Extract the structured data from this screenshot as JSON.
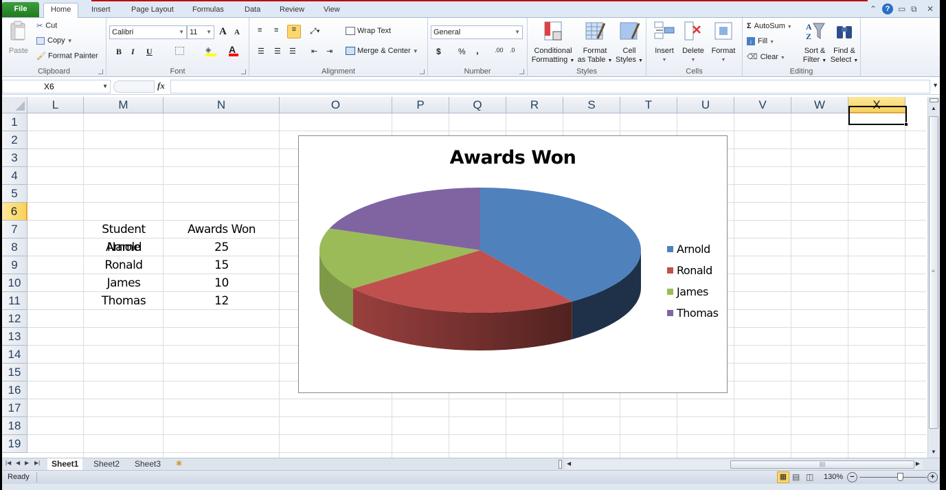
{
  "ribbon_tabs": [
    "File",
    "Home",
    "Insert",
    "Page Layout",
    "Formulas",
    "Data",
    "Review",
    "View"
  ],
  "active_tab": "Home",
  "window_controls": {
    "minimize_ribbon": "⌃",
    "help": "?",
    "minimize": "▭",
    "restore": "⧉",
    "close": "✕"
  },
  "clipboard": {
    "paste": "Paste",
    "cut": "Cut",
    "copy": "Copy",
    "format_painter": "Format Painter",
    "label": "Clipboard"
  },
  "font": {
    "name": "Calibri",
    "size": "11",
    "grow": "A",
    "shrink": "A",
    "bold": "B",
    "italic": "I",
    "underline": "U",
    "label": "Font",
    "fill_color": "#ffff00",
    "font_color": "#ff0000"
  },
  "alignment": {
    "wrap_text": "Wrap Text",
    "merge_center": "Merge & Center",
    "label": "Alignment"
  },
  "number": {
    "format": "General",
    "currency": "$",
    "percent": "%",
    "comma": ",",
    "inc_decimal": ".00",
    "dec_decimal": ".0",
    "label": "Number"
  },
  "styles": {
    "conditional_formatting": [
      "Conditional",
      "Formatting"
    ],
    "format_as_table": [
      "Format",
      "as Table"
    ],
    "cell_styles": [
      "Cell",
      "Styles"
    ],
    "label": "Styles"
  },
  "cells": {
    "insert": "Insert",
    "delete": "Delete",
    "format": "Format",
    "label": "Cells"
  },
  "editing": {
    "autosum": "AutoSum",
    "fill": "Fill",
    "clear": "Clear",
    "sort_filter": [
      "Sort &",
      "Filter"
    ],
    "find_select": [
      "Find &",
      "Select"
    ],
    "label": "Editing"
  },
  "formula_bar": {
    "name_box": "X6",
    "fx": "fx",
    "formula": ""
  },
  "columns": [
    "L",
    "M",
    "N",
    "O",
    "P",
    "Q",
    "R",
    "S",
    "T",
    "U",
    "V",
    "W",
    "X"
  ],
  "selected_column": "X",
  "rows": [
    "1",
    "2",
    "3",
    "4",
    "5",
    "6",
    "7",
    "8",
    "9",
    "10",
    "11",
    "12",
    "13",
    "14",
    "15",
    "16",
    "17",
    "18",
    "19"
  ],
  "selected_row": "6",
  "table": {
    "headers": [
      "Student Name",
      "Awards Won"
    ],
    "rows": [
      [
        "Arnold",
        "25"
      ],
      [
        "Ronald",
        "15"
      ],
      [
        "James",
        "10"
      ],
      [
        "Thomas",
        "12"
      ]
    ]
  },
  "chart_data": {
    "type": "pie",
    "style": "3d",
    "title": "Awards Won",
    "categories": [
      "Arnold",
      "Ronald",
      "James",
      "Thomas"
    ],
    "values": [
      25,
      15,
      10,
      12
    ],
    "colors": [
      "#4f81bd",
      "#c0504d",
      "#9bbb59",
      "#8064a2"
    ],
    "legend": "right"
  },
  "sheets": [
    "Sheet1",
    "Sheet2",
    "Sheet3"
  ],
  "active_sheet": "Sheet1",
  "status": {
    "mode": "Ready",
    "zoom": "130%",
    "zoom_fraction": 0.6
  }
}
